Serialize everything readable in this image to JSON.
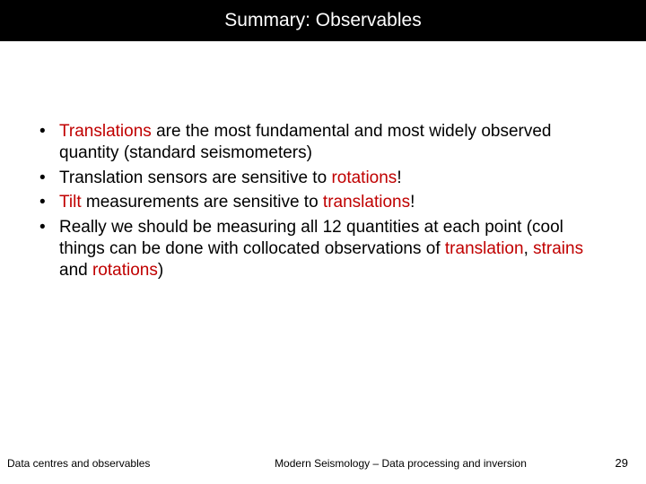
{
  "title": "Summary: Observables",
  "bullets": {
    "b1": {
      "t1": "Translations",
      "t2": " are the most fundamental and most widely observed quantity (standard seismometers)"
    },
    "b2": {
      "t1": "Translation sensors are sensitive to ",
      "t2": "rotations",
      "t3": "!"
    },
    "b3": {
      "t1": "Tilt",
      "t2": " measurements are sensitive to ",
      "t3": "translations",
      "t4": "!"
    },
    "b4": {
      "t1": "Really we should be measuring all 12 quantities at each point (cool things can be done with collocated observations of ",
      "t2": "translation",
      "t3": ", ",
      "t4": "strains",
      "t5": " and ",
      "t6": "rotations",
      "t7": ")"
    }
  },
  "footer": {
    "left": "Data centres and observables",
    "center": "Modern Seismology – Data processing and inversion",
    "page": "29"
  }
}
